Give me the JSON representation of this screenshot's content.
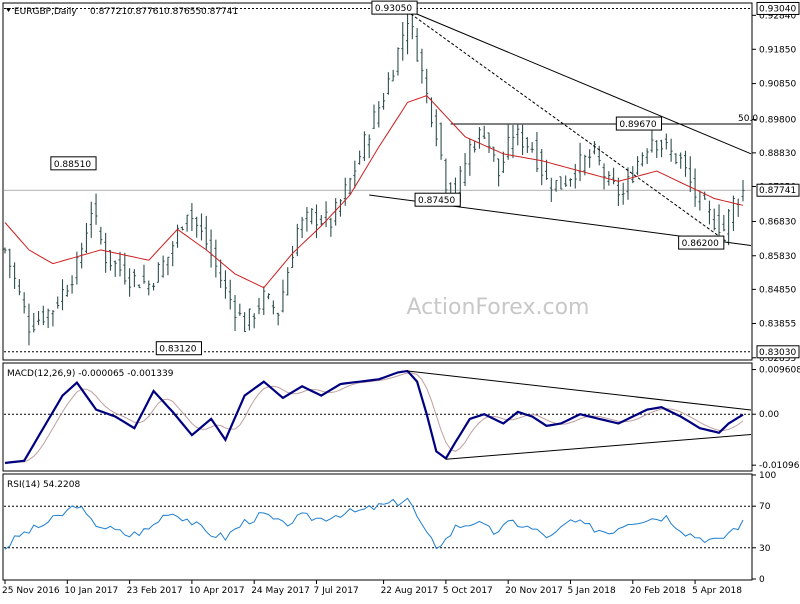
{
  "chart_data": {
    "type": "line",
    "instrument_label": "EURGBP,Daily",
    "ohlc_readout": [
      "0.87721",
      "0.87761",
      "0.87655",
      "0.87741"
    ],
    "watermark": "ActionForex.com",
    "x_tick_labels": [
      "25 Nov 2016",
      "10 Jan 2017",
      "23 Feb 2017",
      "10 Apr 2017",
      "24 May 2017",
      "7 Jul 2017",
      "22 Aug 2017",
      "5 Oct 2017",
      "20 Nov 2017",
      "5 Jan 2018",
      "20 Feb 2018",
      "5 Apr 2018"
    ],
    "colors": {
      "price": "#2f4f4f",
      "ma": "#cc1f1f",
      "trendline": "#000000",
      "macd": "#000080",
      "signal": "#c0a0a0",
      "rsi": "#1f7fd0",
      "level_line": "#000000"
    },
    "price_panel": {
      "ylim": [
        0.8282,
        0.9317
      ],
      "y_tick_labels": [
        "0.92840",
        "0.91850",
        "0.90850",
        "0.89800",
        "0.88830",
        "0.87850",
        "0.86830",
        "0.85830",
        "0.84850",
        "0.83855",
        "0.82855"
      ],
      "y_tick_values": [
        0.9284,
        0.9185,
        0.9085,
        0.898,
        0.8883,
        0.8785,
        0.8683,
        0.8583,
        0.8485,
        0.83855,
        0.82855
      ],
      "current_price_label": "0.87741",
      "current_price": 0.87741,
      "levels": [
        {
          "label": "0.93040",
          "value": 0.9304
        },
        {
          "label": "0.83030",
          "value": 0.8303
        }
      ],
      "fib_label": "50.0",
      "fib_value": 0.8967,
      "annotations": [
        {
          "label": "0.93050",
          "value": 0.9305
        },
        {
          "label": "0.88510",
          "value": 0.8851
        },
        {
          "label": "0.87450",
          "value": 0.8745
        },
        {
          "label": "0.89670",
          "value": 0.8967
        },
        {
          "label": "0.86200",
          "value": 0.862
        },
        {
          "label": "0.83120",
          "value": 0.8312
        }
      ],
      "close_anchors": [
        [
          0,
          0.86
        ],
        [
          5,
          0.838
        ],
        [
          10,
          0.843
        ],
        [
          15,
          0.855
        ],
        [
          18,
          0.872
        ],
        [
          21,
          0.858
        ],
        [
          26,
          0.852
        ],
        [
          30,
          0.85
        ],
        [
          34,
          0.858
        ],
        [
          38,
          0.872
        ],
        [
          42,
          0.862
        ],
        [
          46,
          0.848
        ],
        [
          50,
          0.838
        ],
        [
          54,
          0.846
        ],
        [
          57,
          0.842
        ],
        [
          61,
          0.866
        ],
        [
          64,
          0.87
        ],
        [
          68,
          0.868
        ],
        [
          72,
          0.88
        ],
        [
          76,
          0.895
        ],
        [
          79,
          0.905
        ],
        [
          82,
          0.918
        ],
        [
          84,
          0.928
        ],
        [
          86,
          0.918
        ],
        [
          88,
          0.905
        ],
        [
          90,
          0.895
        ],
        [
          92,
          0.88
        ],
        [
          94,
          0.876
        ],
        [
          97,
          0.89
        ],
        [
          100,
          0.895
        ],
        [
          103,
          0.882
        ],
        [
          106,
          0.894
        ],
        [
          110,
          0.89
        ],
        [
          113,
          0.88
        ],
        [
          116,
          0.879
        ],
        [
          120,
          0.885
        ],
        [
          123,
          0.888
        ],
        [
          126,
          0.879
        ],
        [
          129,
          0.876
        ],
        [
          132,
          0.886
        ],
        [
          135,
          0.893
        ],
        [
          139,
          0.888
        ],
        [
          141,
          0.886
        ],
        [
          144,
          0.876
        ],
        [
          147,
          0.87
        ],
        [
          150,
          0.866
        ],
        [
          152,
          0.874
        ],
        [
          154,
          0.877
        ]
      ],
      "ma_anchors": [
        [
          0,
          0.868
        ],
        [
          5,
          0.86
        ],
        [
          10,
          0.856
        ],
        [
          20,
          0.86
        ],
        [
          30,
          0.857
        ],
        [
          36,
          0.866
        ],
        [
          42,
          0.86
        ],
        [
          48,
          0.853
        ],
        [
          54,
          0.849
        ],
        [
          60,
          0.859
        ],
        [
          66,
          0.867
        ],
        [
          72,
          0.876
        ],
        [
          78,
          0.89
        ],
        [
          84,
          0.903
        ],
        [
          88,
          0.905
        ],
        [
          92,
          0.899
        ],
        [
          96,
          0.893
        ],
        [
          104,
          0.888
        ],
        [
          112,
          0.886
        ],
        [
          120,
          0.883
        ],
        [
          128,
          0.88
        ],
        [
          136,
          0.883
        ],
        [
          142,
          0.879
        ],
        [
          148,
          0.875
        ],
        [
          154,
          0.873
        ]
      ],
      "trendlines": [
        {
          "from": [
            83,
            0.9305
          ],
          "to": [
            160,
            0.8855
          ]
        },
        {
          "from": [
            83,
            0.9305
          ],
          "to": [
            151,
            0.862
          ]
        },
        {
          "from": [
            76,
            0.876
          ],
          "to": [
            160,
            0.8605
          ]
        }
      ],
      "fib_from_index": 93
    },
    "macd_panel": {
      "label": "MACD(12,26,9) -0.000065 -0.001339",
      "ylim": [
        -0.012,
        0.0108
      ],
      "y_tick_labels": [
        "0.009608",
        "0.00",
        "-0.010961"
      ],
      "y_tick_values": [
        0.009608,
        0.0,
        -0.010961
      ],
      "macd_anchors": [
        [
          0,
          -0.0105
        ],
        [
          4,
          -0.01
        ],
        [
          8,
          -0.003
        ],
        [
          12,
          0.004
        ],
        [
          15,
          0.0068
        ],
        [
          19,
          0.001
        ],
        [
          23,
          -0.0005
        ],
        [
          27,
          -0.003
        ],
        [
          31,
          0.005
        ],
        [
          35,
          0.0005
        ],
        [
          39,
          -0.0045
        ],
        [
          43,
          -0.001
        ],
        [
          46,
          -0.0055
        ],
        [
          50,
          0.004
        ],
        [
          54,
          0.007
        ],
        [
          58,
          0.0035
        ],
        [
          62,
          0.006
        ],
        [
          66,
          0.004
        ],
        [
          70,
          0.0065
        ],
        [
          74,
          0.007
        ],
        [
          78,
          0.0075
        ],
        [
          82,
          0.009
        ],
        [
          84,
          0.0093
        ],
        [
          86,
          0.007
        ],
        [
          88,
          0.0
        ],
        [
          90,
          -0.008
        ],
        [
          92,
          -0.0095
        ],
        [
          94,
          -0.006
        ],
        [
          97,
          -0.001
        ],
        [
          100,
          0.0
        ],
        [
          104,
          -0.002
        ],
        [
          107,
          0.0005
        ],
        [
          110,
          -0.0005
        ],
        [
          113,
          -0.0025
        ],
        [
          116,
          -0.002
        ],
        [
          120,
          0.0
        ],
        [
          124,
          -0.001
        ],
        [
          128,
          -0.002
        ],
        [
          131,
          -0.0005
        ],
        [
          134,
          0.001
        ],
        [
          137,
          0.0015
        ],
        [
          141,
          -0.0005
        ],
        [
          145,
          -0.003
        ],
        [
          149,
          -0.004
        ],
        [
          151,
          -0.002
        ],
        [
          154,
          -0.0001
        ]
      ],
      "trendlines": [
        {
          "from": [
            84,
            0.0093
          ],
          "to": [
            160,
            0.0004
          ]
        },
        {
          "from": [
            92,
            -0.0097
          ],
          "to": [
            160,
            -0.004
          ]
        }
      ]
    },
    "rsi_panel": {
      "label": "RSI(14) 54.2208",
      "ylim": [
        0,
        100
      ],
      "y_tick_labels": [
        "100",
        "70",
        "30",
        "0"
      ],
      "y_tick_values": [
        100,
        70,
        30,
        0
      ],
      "levels": [
        70,
        30
      ],
      "rsi_anchors": [
        [
          0,
          30
        ],
        [
          3,
          42
        ],
        [
          7,
          50
        ],
        [
          12,
          62
        ],
        [
          15,
          72
        ],
        [
          18,
          55
        ],
        [
          22,
          48
        ],
        [
          26,
          42
        ],
        [
          30,
          48
        ],
        [
          34,
          65
        ],
        [
          38,
          58
        ],
        [
          42,
          45
        ],
        [
          46,
          40
        ],
        [
          50,
          55
        ],
        [
          54,
          62
        ],
        [
          58,
          52
        ],
        [
          62,
          60
        ],
        [
          66,
          58
        ],
        [
          70,
          63
        ],
        [
          74,
          65
        ],
        [
          78,
          70
        ],
        [
          82,
          74
        ],
        [
          84,
          78
        ],
        [
          86,
          60
        ],
        [
          88,
          42
        ],
        [
          90,
          32
        ],
        [
          92,
          38
        ],
        [
          94,
          50
        ],
        [
          98,
          55
        ],
        [
          102,
          45
        ],
        [
          106,
          55
        ],
        [
          110,
          48
        ],
        [
          114,
          40
        ],
        [
          118,
          56
        ],
        [
          122,
          50
        ],
        [
          126,
          45
        ],
        [
          130,
          55
        ],
        [
          134,
          58
        ],
        [
          138,
          60
        ],
        [
          142,
          45
        ],
        [
          145,
          40
        ],
        [
          149,
          36
        ],
        [
          151,
          45
        ],
        [
          154,
          54
        ]
      ]
    }
  }
}
